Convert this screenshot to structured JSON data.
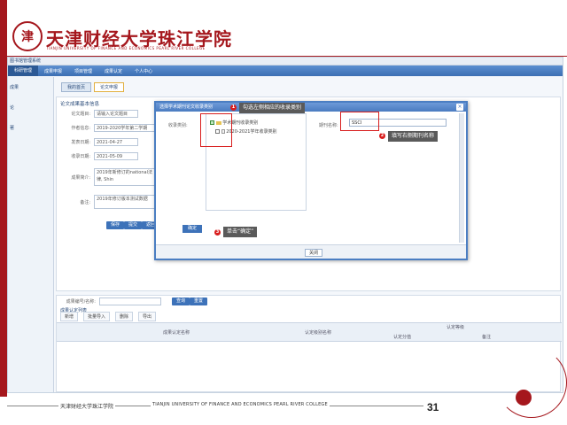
{
  "header": {
    "seal_text": "津",
    "title_cn": "天津财经大学珠江学院",
    "title_en": "TIANJIN UNIVERSITY OF FINANCE AND ECONOMICS PEARL RIVER COLLEGE"
  },
  "app": {
    "topbar_text": "图书馆管理系统",
    "nav_items": [
      "科研管理",
      "成果申报",
      "项目管理",
      "成果认定",
      "个人中心"
    ],
    "sidebar_items": [
      "成果",
      "论",
      "著"
    ],
    "tabs": [
      "我的首页",
      "论文申报"
    ],
    "section_title": "论文成果基本信息",
    "form": {
      "row1_label": "论文题目:",
      "row1_value": "请输入论文题目",
      "row2_label": "作者信息:",
      "row2_value": "2019-2020学年第二学期",
      "row3_label": "发表日期:",
      "row3_value": "2021-04-27",
      "row4_label": "收录日期:",
      "row4_value": "2021-05-09",
      "row5_label": "成果简介:",
      "row5_value": "2019年新修订的national法律, Shin",
      "row6_label": "备注:",
      "row6_value": "2019年修订版本测试数据"
    },
    "form_buttons": [
      "保存",
      "提交",
      "返回列表"
    ],
    "grid": {
      "filter_label": "成果编号/名称:",
      "search_label": "查询",
      "reset_label": "重置",
      "section_title": "成果认定列表",
      "toolbar": [
        "新增",
        "批量导入",
        "删除",
        "导出"
      ],
      "col1": "成果认定名称",
      "col2": "认定级别名称",
      "col3": "认定等级",
      "col3a": "认定分值",
      "col3b": "备注"
    }
  },
  "dialog": {
    "title": "选择学术期刊论文收录类别",
    "close_icon_glyph": "×",
    "tree_label": "收录类别:",
    "tree_items": [
      "学术期刊收录类别",
      "2020-2021学年收录类别"
    ],
    "right_label": "期刊名称:",
    "right_value": "SSCI",
    "confirm_label": "确定",
    "close_button_label": "关闭"
  },
  "callouts": [
    {
      "num": "1",
      "text": "勾选左侧相应的收录类别"
    },
    {
      "num": "2",
      "text": "填写右侧期刊名称"
    },
    {
      "num": "3",
      "text": "单击“确定”"
    }
  ],
  "footer": {
    "cn": "天津财经大学珠江学院",
    "en": "TIANJIN UNIVERSITY OF FINANCE AND ECONOMICS PEARL RIVER COLLEGE",
    "page": "31"
  },
  "colors": {
    "brand_red": "#a5171d",
    "app_blue": "#3d72b9",
    "callout_red": "#d81e1e"
  }
}
